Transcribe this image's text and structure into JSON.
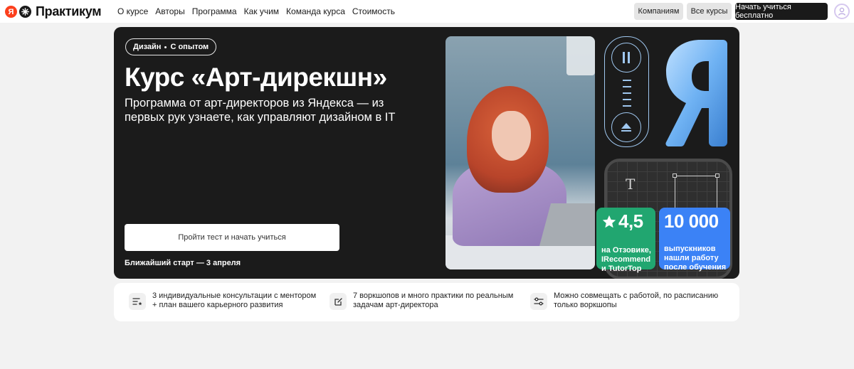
{
  "header": {
    "logo": {
      "ya": "Я",
      "text": "Практикум"
    },
    "nav": [
      "О курсе",
      "Авторы",
      "Программа",
      "Как учим",
      "Команда курса",
      "Стоимость"
    ],
    "buttons": {
      "companies": "Компаниям",
      "all_courses": "Все курсы",
      "start_free": "Начать учиться бесплатно"
    }
  },
  "hero": {
    "tag_left": "Дизайн",
    "tag_right": "С опытом",
    "title": "Курс «Арт-дирекшн»",
    "subtitle": "Программа от арт-директоров из Яндекса — из первых рук узнаете, как управляют дизайном в IT",
    "cta": "Пройти тест и начать учиться",
    "start_date": "Ближайший старт — 3 апреля",
    "stats": {
      "rating": {
        "value": "4,5",
        "label": "на Отзовике,\nIRecommend\nи TutorTop"
      },
      "graduates": {
        "value": "10 000",
        "label": "выпускников\nнашли работу\nпосле обучения"
      }
    },
    "canvas_letter": "T"
  },
  "features": [
    {
      "icon": "list-star-icon",
      "text": "3 индивидуальные консультации с ментором + план вашего карьерного развития"
    },
    {
      "icon": "edit-icon",
      "text": "7 воркшопов и много практики по реальным задачам арт-директора"
    },
    {
      "icon": "sliders-icon",
      "text": "Можно совмещать с работой, по расписанию только воркшопы"
    }
  ],
  "colors": {
    "accent_green": "#21a670",
    "accent_blue": "#3b82f6",
    "hero_bg": "#1b1b1b",
    "logo_red": "#fc3f1d"
  }
}
